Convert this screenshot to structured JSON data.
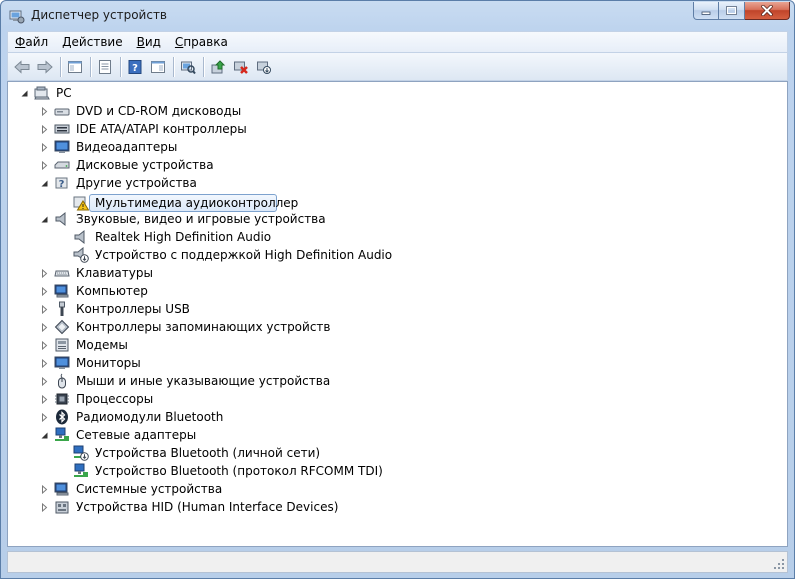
{
  "window": {
    "title": "Диспетчер устройств"
  },
  "menu": [
    {
      "label": "Файл",
      "accel": "Ф",
      "rest": "айл"
    },
    {
      "label": "Действие",
      "accel": "Д",
      "rest": "ействие"
    },
    {
      "label": "Вид",
      "accel": "В",
      "rest": "ид"
    },
    {
      "label": "Справка",
      "accel": "С",
      "rest": "правка"
    }
  ],
  "toolbar": {
    "icons": [
      "back-icon",
      "forward-icon",
      "show-hide-tree-icon",
      "properties-icon",
      "help-icon",
      "action-pane-icon",
      "scan-hardware-icon",
      "update-driver-icon",
      "uninstall-icon",
      "disable-icon"
    ]
  },
  "tree": {
    "root": "PC",
    "items": [
      {
        "label": "DVD и CD-ROM дисководы",
        "icon": "dvd-drive-icon",
        "state": "collapsed"
      },
      {
        "label": "IDE ATA/ATAPI контроллеры",
        "icon": "ide-controller-icon",
        "state": "collapsed"
      },
      {
        "label": "Видеоадаптеры",
        "icon": "display-adapter-icon",
        "state": "collapsed"
      },
      {
        "label": "Дисковые устройства",
        "icon": "disk-drive-icon",
        "state": "collapsed"
      },
      {
        "label": "Другие устройства",
        "icon": "unknown-device-icon",
        "state": "expanded",
        "children": [
          {
            "label": "Мультимедиа аудиоконтроллер",
            "icon": "warning-device-icon",
            "selected": true
          }
        ]
      },
      {
        "label": "Звуковые, видео и игровые устройства",
        "icon": "speaker-icon",
        "state": "expanded",
        "children": [
          {
            "label": "Realtek High Definition Audio",
            "icon": "speaker-icon"
          },
          {
            "label": "Устройство с поддержкой High Definition Audio",
            "icon": "speaker-disabled-icon"
          }
        ]
      },
      {
        "label": "Клавиатуры",
        "icon": "keyboard-icon",
        "state": "collapsed"
      },
      {
        "label": "Компьютер",
        "icon": "computer-icon",
        "state": "collapsed"
      },
      {
        "label": "Контроллеры USB",
        "icon": "usb-icon",
        "state": "collapsed"
      },
      {
        "label": "Контроллеры запоминающих устройств",
        "icon": "storage-controller-icon",
        "state": "collapsed"
      },
      {
        "label": "Модемы",
        "icon": "modem-icon",
        "state": "collapsed"
      },
      {
        "label": "Мониторы",
        "icon": "monitor-icon",
        "state": "collapsed"
      },
      {
        "label": "Мыши и иные указывающие устройства",
        "icon": "mouse-icon",
        "state": "collapsed"
      },
      {
        "label": "Процессоры",
        "icon": "processor-icon",
        "state": "collapsed"
      },
      {
        "label": "Радиомодули Bluetooth",
        "icon": "bluetooth-icon",
        "state": "collapsed"
      },
      {
        "label": "Сетевые адаптеры",
        "icon": "network-adapter-icon",
        "state": "expanded",
        "children": [
          {
            "label": "Устройства Bluetooth (личной сети)",
            "icon": "network-disabled-icon"
          },
          {
            "label": "Устройство Bluetooth (протокол RFCOMM TDI)",
            "icon": "network-adapter-icon"
          }
        ]
      },
      {
        "label": "Системные устройства",
        "icon": "system-device-icon",
        "state": "collapsed"
      },
      {
        "label": "Устройства HID (Human Interface Devices)",
        "icon": "hid-icon",
        "state": "collapsed"
      }
    ]
  }
}
